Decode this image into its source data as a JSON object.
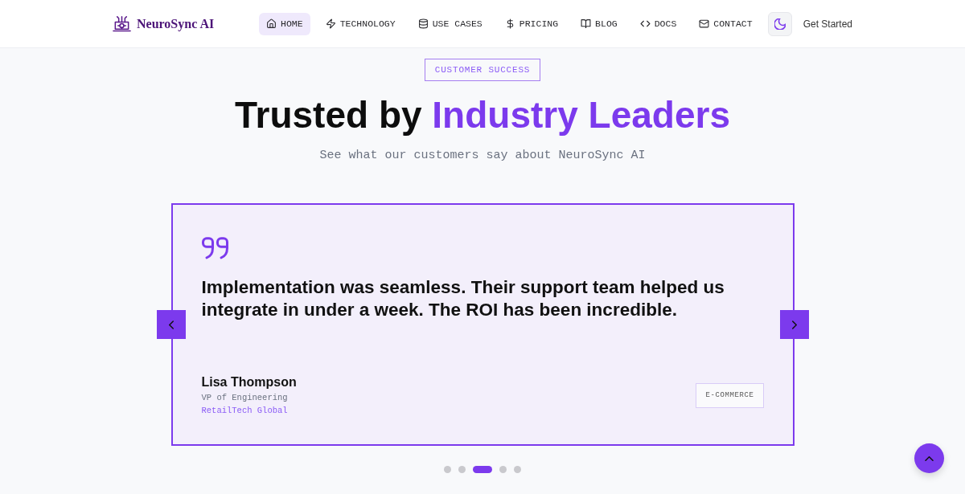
{
  "header": {
    "brand": "NeuroSync AI",
    "nav": [
      {
        "label": "HOME",
        "selected": true
      },
      {
        "label": "TECHNOLOGY",
        "selected": false
      },
      {
        "label": "USE CASES",
        "selected": false
      },
      {
        "label": "PRICING",
        "selected": false
      },
      {
        "label": "BLOG",
        "selected": false
      },
      {
        "label": "DOCS",
        "selected": false
      },
      {
        "label": "CONTACT",
        "selected": false
      }
    ],
    "cta": "Get Started"
  },
  "section": {
    "badge": "CUSTOMER SUCCESS",
    "title": "Trusted by",
    "title_highlight": "Industry Leaders",
    "subtitle": "See what our customers say about NeuroSync AI"
  },
  "testimonial": {
    "quote": "Implementation was seamless. Their support team helped us integrate in under a week. The ROI has been incredible.",
    "author": "Lisa Thompson",
    "role": "VP of Engineering",
    "company": "RetailTech Global",
    "tag": "E-COMMERCE"
  },
  "carousel_dots": [
    {
      "selected": false
    },
    {
      "selected": false
    },
    {
      "selected": true
    },
    {
      "selected": false
    },
    {
      "selected": false
    }
  ]
}
